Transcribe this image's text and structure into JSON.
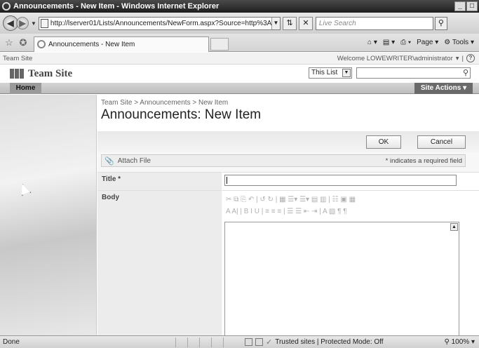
{
  "window": {
    "title": "Announcements - New Item - Windows Internet Explorer",
    "min": "_",
    "max": "□"
  },
  "addressbar": {
    "url": "http://lserver01/Lists/Announcements/NewForm.aspx?Source=http%3A%2F%",
    "search_placeholder": "Live Search"
  },
  "tabbar": {
    "tab_title": "Announcements - New Item",
    "commands": [
      "Page",
      "Tools"
    ]
  },
  "sharepoint": {
    "site_label": "Team Site",
    "welcome": "Welcome LOWEWRITER\\administrator",
    "site_name": "Team Site",
    "search_scope": "This List",
    "nav_home": "Home",
    "site_actions": "Site Actions"
  },
  "page": {
    "breadcrumb": "Team Site > Announcements > New Item",
    "title": "Announcements: New Item"
  },
  "form": {
    "ok": "OK",
    "cancel": "Cancel",
    "attach_file": "Attach File",
    "required_note": "* indicates a required field",
    "fields": [
      {
        "label": "Title *"
      },
      {
        "label": "Body"
      }
    ],
    "rte_row1": "✂ ⧉ ⎘ ↶ | ↺ ↻ | ▦ ☰▾ ☰▾ ▤ ▥ | ☷ ▣ ▦",
    "rte_row2": "A A| | B I U | ≡ ≡ ≡ | ☰ ☰ ⇤ ⇥ | A ▧ ¶ ¶"
  },
  "status": {
    "left": "Done",
    "zone": "Trusted sites | Protected Mode: Off",
    "zoom": "100%"
  }
}
